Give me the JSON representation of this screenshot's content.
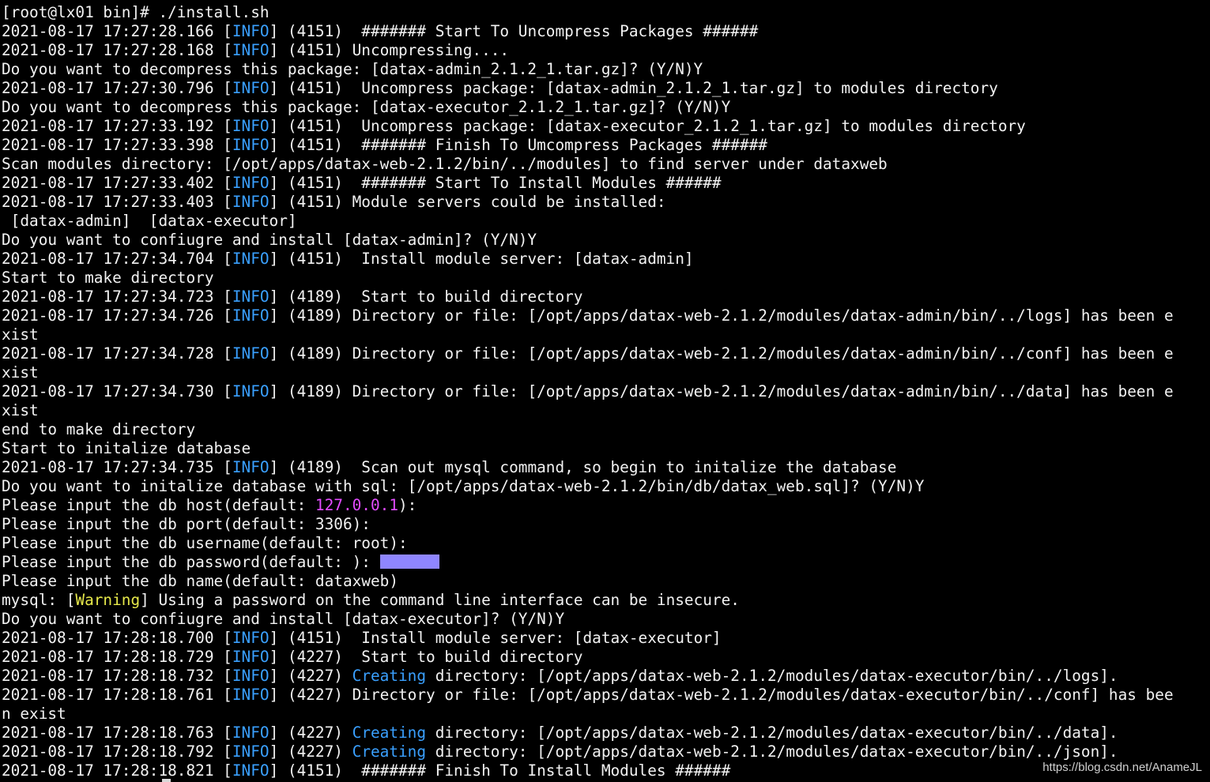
{
  "terminal": {
    "colors": {
      "default": "#f2f2f2",
      "info": "#3aa0ff",
      "warning": "#e6e84a",
      "creating": "#3aa0ff",
      "host": "#e34cff",
      "mask": "#8f86ff"
    },
    "lines": [
      {
        "parts": [
          {
            "t": "[root@lx01 bin]# ./install.sh"
          }
        ]
      },
      {
        "parts": [
          {
            "t": "2021-08-17 17:27:28.166 ["
          },
          {
            "t": "INFO",
            "c": "info"
          },
          {
            "t": "] (4151)  ####### Start To Uncompress Packages ######"
          }
        ]
      },
      {
        "parts": [
          {
            "t": "2021-08-17 17:27:28.168 ["
          },
          {
            "t": "INFO",
            "c": "info"
          },
          {
            "t": "] (4151) Uncompressing...."
          }
        ]
      },
      {
        "parts": [
          {
            "t": "Do you want to decompress this package: [datax-admin_2.1.2_1.tar.gz]? (Y/N)Y"
          }
        ]
      },
      {
        "parts": [
          {
            "t": "2021-08-17 17:27:30.796 ["
          },
          {
            "t": "INFO",
            "c": "info"
          },
          {
            "t": "] (4151)  Uncompress package: [datax-admin_2.1.2_1.tar.gz] to modules directory"
          }
        ]
      },
      {
        "parts": [
          {
            "t": "Do you want to decompress this package: [datax-executor_2.1.2_1.tar.gz]? (Y/N)Y"
          }
        ]
      },
      {
        "parts": [
          {
            "t": "2021-08-17 17:27:33.192 ["
          },
          {
            "t": "INFO",
            "c": "info"
          },
          {
            "t": "] (4151)  Uncompress package: [datax-executor_2.1.2_1.tar.gz] to modules directory"
          }
        ]
      },
      {
        "parts": [
          {
            "t": "2021-08-17 17:27:33.398 ["
          },
          {
            "t": "INFO",
            "c": "info"
          },
          {
            "t": "] (4151)  ####### Finish To Umcompress Packages ######"
          }
        ]
      },
      {
        "parts": [
          {
            "t": "Scan modules directory: [/opt/apps/datax-web-2.1.2/bin/../modules] to find server under dataxweb"
          }
        ]
      },
      {
        "parts": [
          {
            "t": "2021-08-17 17:27:33.402 ["
          },
          {
            "t": "INFO",
            "c": "info"
          },
          {
            "t": "] (4151)  ####### Start To Install Modules ######"
          }
        ]
      },
      {
        "parts": [
          {
            "t": "2021-08-17 17:27:33.403 ["
          },
          {
            "t": "INFO",
            "c": "info"
          },
          {
            "t": "] (4151) Module servers could be installed:"
          }
        ]
      },
      {
        "parts": [
          {
            "t": " [datax-admin]  [datax-executor]"
          }
        ]
      },
      {
        "parts": [
          {
            "t": "Do you want to confiugre and install [datax-admin]? (Y/N)Y"
          }
        ]
      },
      {
        "parts": [
          {
            "t": "2021-08-17 17:27:34.704 ["
          },
          {
            "t": "INFO",
            "c": "info"
          },
          {
            "t": "] (4151)  Install module server: [datax-admin]"
          }
        ]
      },
      {
        "parts": [
          {
            "t": "Start to make directory"
          }
        ]
      },
      {
        "parts": [
          {
            "t": "2021-08-17 17:27:34.723 ["
          },
          {
            "t": "INFO",
            "c": "info"
          },
          {
            "t": "] (4189)  Start to build directory"
          }
        ]
      },
      {
        "parts": [
          {
            "t": "2021-08-17 17:27:34.726 ["
          },
          {
            "t": "INFO",
            "c": "info"
          },
          {
            "t": "] (4189) Directory or file: [/opt/apps/datax-web-2.1.2/modules/datax-admin/bin/../logs] has been e"
          }
        ]
      },
      {
        "parts": [
          {
            "t": "xist"
          }
        ]
      },
      {
        "parts": [
          {
            "t": "2021-08-17 17:27:34.728 ["
          },
          {
            "t": "INFO",
            "c": "info"
          },
          {
            "t": "] (4189) Directory or file: [/opt/apps/datax-web-2.1.2/modules/datax-admin/bin/../conf] has been e"
          }
        ]
      },
      {
        "parts": [
          {
            "t": "xist"
          }
        ]
      },
      {
        "parts": [
          {
            "t": "2021-08-17 17:27:34.730 ["
          },
          {
            "t": "INFO",
            "c": "info"
          },
          {
            "t": "] (4189) Directory or file: [/opt/apps/datax-web-2.1.2/modules/datax-admin/bin/../data] has been e"
          }
        ]
      },
      {
        "parts": [
          {
            "t": "xist"
          }
        ]
      },
      {
        "parts": [
          {
            "t": "end to make directory"
          }
        ]
      },
      {
        "parts": [
          {
            "t": "Start to initalize database"
          }
        ]
      },
      {
        "parts": [
          {
            "t": "2021-08-17 17:27:34.735 ["
          },
          {
            "t": "INFO",
            "c": "info"
          },
          {
            "t": "] (4189)  Scan out mysql command, so begin to initalize the database"
          }
        ]
      },
      {
        "parts": [
          {
            "t": "Do you want to initalize database with sql: [/opt/apps/datax-web-2.1.2/bin/db/datax_web.sql]? (Y/N)Y"
          }
        ]
      },
      {
        "parts": [
          {
            "t": "Please input the db host(default: "
          },
          {
            "t": "127.0.0.1",
            "c": "host"
          },
          {
            "t": "):"
          }
        ]
      },
      {
        "parts": [
          {
            "t": "Please input the db port(default: 3306):"
          }
        ]
      },
      {
        "parts": [
          {
            "t": "Please input the db username(default: root):"
          }
        ]
      },
      {
        "parts": [
          {
            "t": "Please input the db password(default: ): "
          },
          {
            "mask": true
          }
        ]
      },
      {
        "parts": [
          {
            "t": "Please input the db name(default: dataxweb)"
          }
        ]
      },
      {
        "parts": [
          {
            "t": "mysql: ["
          },
          {
            "t": "Warning",
            "c": "warning"
          },
          {
            "t": "] Using a password on the command line interface can be insecure."
          }
        ]
      },
      {
        "parts": [
          {
            "t": "Do you want to confiugre and install [datax-executor]? (Y/N)Y"
          }
        ]
      },
      {
        "parts": [
          {
            "t": "2021-08-17 17:28:18.700 ["
          },
          {
            "t": "INFO",
            "c": "info"
          },
          {
            "t": "] (4151)  Install module server: [datax-executor]"
          }
        ]
      },
      {
        "parts": [
          {
            "t": "2021-08-17 17:28:18.729 ["
          },
          {
            "t": "INFO",
            "c": "info"
          },
          {
            "t": "] (4227)  Start to build directory"
          }
        ]
      },
      {
        "parts": [
          {
            "t": "2021-08-17 17:28:18.732 ["
          },
          {
            "t": "INFO",
            "c": "info"
          },
          {
            "t": "] (4227) "
          },
          {
            "t": "Creating",
            "c": "creating"
          },
          {
            "t": " directory: [/opt/apps/datax-web-2.1.2/modules/datax-executor/bin/../logs]."
          }
        ]
      },
      {
        "parts": [
          {
            "t": "2021-08-17 17:28:18.761 ["
          },
          {
            "t": "INFO",
            "c": "info"
          },
          {
            "t": "] (4227) Directory or file: [/opt/apps/datax-web-2.1.2/modules/datax-executor/bin/../conf] has bee"
          }
        ]
      },
      {
        "parts": [
          {
            "t": "n exist"
          }
        ]
      },
      {
        "parts": [
          {
            "t": "2021-08-17 17:28:18.763 ["
          },
          {
            "t": "INFO",
            "c": "info"
          },
          {
            "t": "] (4227) "
          },
          {
            "t": "Creating",
            "c": "creating"
          },
          {
            "t": " directory: [/opt/apps/datax-web-2.1.2/modules/datax-executor/bin/../data]."
          }
        ]
      },
      {
        "parts": [
          {
            "t": "2021-08-17 17:28:18.792 ["
          },
          {
            "t": "INFO",
            "c": "info"
          },
          {
            "t": "] (4227) "
          },
          {
            "t": "Creating",
            "c": "creating"
          },
          {
            "t": " directory: [/opt/apps/datax-web-2.1.2/modules/datax-executor/bin/../json]."
          }
        ]
      },
      {
        "parts": [
          {
            "t": "2021-08-17 17:28:18.821 ["
          },
          {
            "t": "INFO",
            "c": "info"
          },
          {
            "t": "] (4151)  ####### Finish To Install Modules ######"
          }
        ]
      }
    ]
  },
  "watermark": "https://blog.csdn.net/AnameJL"
}
